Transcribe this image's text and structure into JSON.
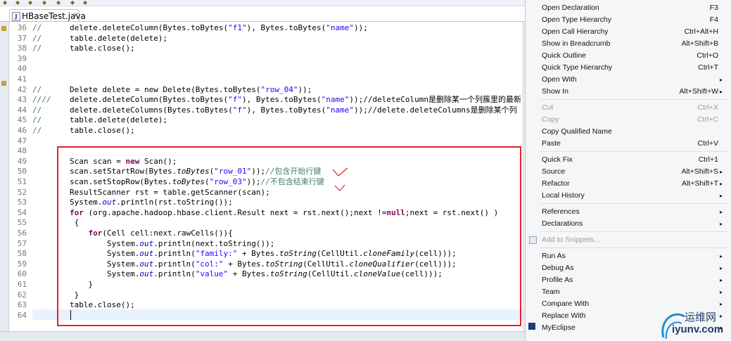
{
  "editor": {
    "tab": {
      "file_name": "HBaseTest.java",
      "icon_letter": "J",
      "close_glyph": "✕"
    },
    "lines": [
      {
        "n": "36",
        "t": [
          [
            "cm",
            "//"
          ],
          [
            "",
            "      "
          ],
          [
            "",
            "delete.deleteColumn(Bytes.toBytes("
          ],
          [
            "st",
            "\"f1\""
          ],
          [
            "",
            ""
          ],
          [
            "",
            "), Bytes.toBytes("
          ],
          [
            "st",
            "\"name\""
          ],
          [
            "",
            "));"
          ]
        ]
      },
      {
        "n": "37",
        "t": [
          [
            "cm",
            "//"
          ],
          [
            "",
            "      table.delete(delete);"
          ]
        ]
      },
      {
        "n": "38",
        "t": [
          [
            "cm",
            "//"
          ],
          [
            "",
            "      table.close();"
          ]
        ]
      },
      {
        "n": "39",
        "t": []
      },
      {
        "n": "40",
        "t": []
      },
      {
        "n": "41",
        "t": []
      },
      {
        "n": "42",
        "t": [
          [
            "cm",
            "//"
          ],
          [
            "",
            "      Delete delete = new Delete(Bytes.toBytes("
          ],
          [
            "st",
            "\"row_04\""
          ],
          [
            "",
            "));"
          ]
        ]
      },
      {
        "n": "43",
        "t": [
          [
            "cm",
            "////"
          ],
          [
            "",
            "    delete.deleteColumn(Bytes.toBytes("
          ],
          [
            "st",
            "\"f\""
          ],
          [
            "",
            "), Bytes.toBytes("
          ],
          [
            "st",
            "\"name\""
          ],
          [
            "",
            "));//deleteColumn是删除某一个列簇里的最新"
          ]
        ]
      },
      {
        "n": "44",
        "t": [
          [
            "cm",
            "//"
          ],
          [
            "",
            "      delete.deleteColumns(Bytes.toBytes("
          ],
          [
            "st",
            "\"f\""
          ],
          [
            "",
            "), Bytes.toBytes("
          ],
          [
            "st",
            "\"name\""
          ],
          [
            "",
            "));//delete.deleteColumns是删除某个列"
          ]
        ]
      },
      {
        "n": "45",
        "t": [
          [
            "cm",
            "//"
          ],
          [
            "",
            "      table.delete(delete);"
          ]
        ]
      },
      {
        "n": "46",
        "t": [
          [
            "cm",
            "//"
          ],
          [
            "",
            "      table.close();"
          ]
        ]
      },
      {
        "n": "47",
        "t": []
      },
      {
        "n": "48",
        "t": []
      },
      {
        "n": "49",
        "t": [
          [
            "",
            "        Scan scan = "
          ],
          [
            "kw",
            "new"
          ],
          [
            "",
            " Scan();"
          ]
        ]
      },
      {
        "n": "50",
        "t": [
          [
            "",
            "        scan.setStartRow(Bytes."
          ],
          [
            "it",
            "toBytes"
          ],
          [
            "",
            "("
          ],
          [
            "st",
            "\"row_01\""
          ],
          [
            "",
            "));"
          ],
          [
            "cm",
            "//包含开始行键"
          ]
        ]
      },
      {
        "n": "51",
        "t": [
          [
            "",
            "        scan.setStopRow(Bytes."
          ],
          [
            "it",
            "toBytes"
          ],
          [
            "",
            "("
          ],
          [
            "st",
            "\"row_03\""
          ],
          [
            "",
            "));"
          ],
          [
            "cm",
            "//不包含结束行键"
          ]
        ]
      },
      {
        "n": "52",
        "t": [
          [
            "",
            "        ResultScanner rst = table.getScanner(scan);"
          ]
        ]
      },
      {
        "n": "53",
        "t": [
          [
            "",
            "        System."
          ],
          [
            "fi",
            "out"
          ],
          [
            "",
            ".println(rst.toString());"
          ]
        ]
      },
      {
        "n": "54",
        "t": [
          [
            "",
            "        "
          ],
          [
            "kw",
            "for"
          ],
          [
            "",
            " (org.apache.hadoop.hbase.client.Result next = rst.next();next !="
          ],
          [
            "kw",
            "null"
          ],
          [
            "",
            ";next = rst.next() )"
          ]
        ]
      },
      {
        "n": "55",
        "t": [
          [
            "",
            "         {"
          ]
        ]
      },
      {
        "n": "56",
        "t": [
          [
            "",
            "            "
          ],
          [
            "kw",
            "for"
          ],
          [
            "",
            "(Cell cell:next.rawCells()){"
          ]
        ]
      },
      {
        "n": "57",
        "t": [
          [
            "",
            "                System."
          ],
          [
            "fi",
            "out"
          ],
          [
            "",
            ".println(next.toString());"
          ]
        ]
      },
      {
        "n": "58",
        "t": [
          [
            "",
            "                System."
          ],
          [
            "fi",
            "out"
          ],
          [
            "",
            ".println("
          ],
          [
            "st",
            "\"family:\""
          ],
          [
            "",
            " + Bytes."
          ],
          [
            "it",
            "toString"
          ],
          [
            "",
            "(CellUtil."
          ],
          [
            "it",
            "cloneFamily"
          ],
          [
            "",
            "(cell)));"
          ]
        ]
      },
      {
        "n": "59",
        "t": [
          [
            "",
            "                System."
          ],
          [
            "fi",
            "out"
          ],
          [
            "",
            ".println("
          ],
          [
            "st",
            "\"col:\""
          ],
          [
            "",
            " + Bytes."
          ],
          [
            "it",
            "toString"
          ],
          [
            "",
            "(CellUtil."
          ],
          [
            "it",
            "cloneQualifier"
          ],
          [
            "",
            "(cell)));"
          ]
        ]
      },
      {
        "n": "60",
        "t": [
          [
            "",
            "                System."
          ],
          [
            "fi",
            "out"
          ],
          [
            "",
            ".println("
          ],
          [
            "st",
            "\"value\""
          ],
          [
            "",
            " + Bytes."
          ],
          [
            "it",
            "toString"
          ],
          [
            "",
            "(CellUtil."
          ],
          [
            "it",
            "cloneValue"
          ],
          [
            "",
            "(cell)));"
          ]
        ]
      },
      {
        "n": "61",
        "t": [
          [
            "",
            "            }"
          ]
        ]
      },
      {
        "n": "62",
        "t": [
          [
            "",
            "         }"
          ]
        ]
      },
      {
        "n": "63",
        "t": [
          [
            "",
            "        table.close();"
          ]
        ]
      },
      {
        "n": "64",
        "t": [
          [
            "",
            "        "
          ]
        ]
      }
    ]
  },
  "context_menu": {
    "items": [
      {
        "label": "Open Declaration",
        "shortcut": "F3",
        "enabled": true,
        "submenu": false
      },
      {
        "label": "Open Type Hierarchy",
        "shortcut": "F4",
        "enabled": true,
        "submenu": false
      },
      {
        "label": "Open Call Hierarchy",
        "shortcut": "Ctrl+Alt+H",
        "enabled": true,
        "submenu": false
      },
      {
        "label": "Show in Breadcrumb",
        "shortcut": "Alt+Shift+B",
        "enabled": true,
        "submenu": false
      },
      {
        "label": "Quick Outline",
        "shortcut": "Ctrl+O",
        "enabled": true,
        "submenu": false
      },
      {
        "label": "Quick Type Hierarchy",
        "shortcut": "Ctrl+T",
        "enabled": true,
        "submenu": false
      },
      {
        "label": "Open With",
        "shortcut": "",
        "enabled": true,
        "submenu": true
      },
      {
        "label": "Show In",
        "shortcut": "Alt+Shift+W",
        "enabled": true,
        "submenu": true
      },
      {
        "label": "Cut",
        "shortcut": "Ctrl+X",
        "enabled": false,
        "submenu": false
      },
      {
        "label": "Copy",
        "shortcut": "Ctrl+C",
        "enabled": false,
        "submenu": false
      },
      {
        "label": "Copy Qualified Name",
        "shortcut": "",
        "enabled": true,
        "submenu": false
      },
      {
        "label": "Paste",
        "shortcut": "Ctrl+V",
        "enabled": true,
        "submenu": false
      },
      {
        "label": "Quick Fix",
        "shortcut": "Ctrl+1",
        "enabled": true,
        "submenu": false
      },
      {
        "label": "Source",
        "shortcut": "Alt+Shift+S",
        "enabled": true,
        "submenu": true
      },
      {
        "label": "Refactor",
        "shortcut": "Alt+Shift+T",
        "enabled": true,
        "submenu": true
      },
      {
        "label": "Local History",
        "shortcut": "",
        "enabled": true,
        "submenu": true
      },
      {
        "label": "References",
        "shortcut": "",
        "enabled": true,
        "submenu": true
      },
      {
        "label": "Declarations",
        "shortcut": "",
        "enabled": true,
        "submenu": true
      },
      {
        "label": "Add to Snippets...",
        "shortcut": "",
        "enabled": false,
        "submenu": false
      },
      {
        "label": "Run As",
        "shortcut": "",
        "enabled": true,
        "submenu": true
      },
      {
        "label": "Debug As",
        "shortcut": "",
        "enabled": true,
        "submenu": true
      },
      {
        "label": "Profile As",
        "shortcut": "",
        "enabled": true,
        "submenu": true
      },
      {
        "label": "Team",
        "shortcut": "",
        "enabled": true,
        "submenu": true
      },
      {
        "label": "Compare With",
        "shortcut": "",
        "enabled": true,
        "submenu": true
      },
      {
        "label": "Replace With",
        "shortcut": "",
        "enabled": true,
        "submenu": true
      },
      {
        "label": "MyEclipse",
        "shortcut": "",
        "enabled": true,
        "submenu": true
      }
    ],
    "submenu_arrow": "▸"
  },
  "watermark": {
    "cn_text": "运维网",
    "url_text": "iyunv.com"
  },
  "colors": {
    "highlight_box": "#e8202a",
    "comment": "#3f7f5f",
    "keyword": "#7f0055",
    "string": "#2a00ff"
  }
}
